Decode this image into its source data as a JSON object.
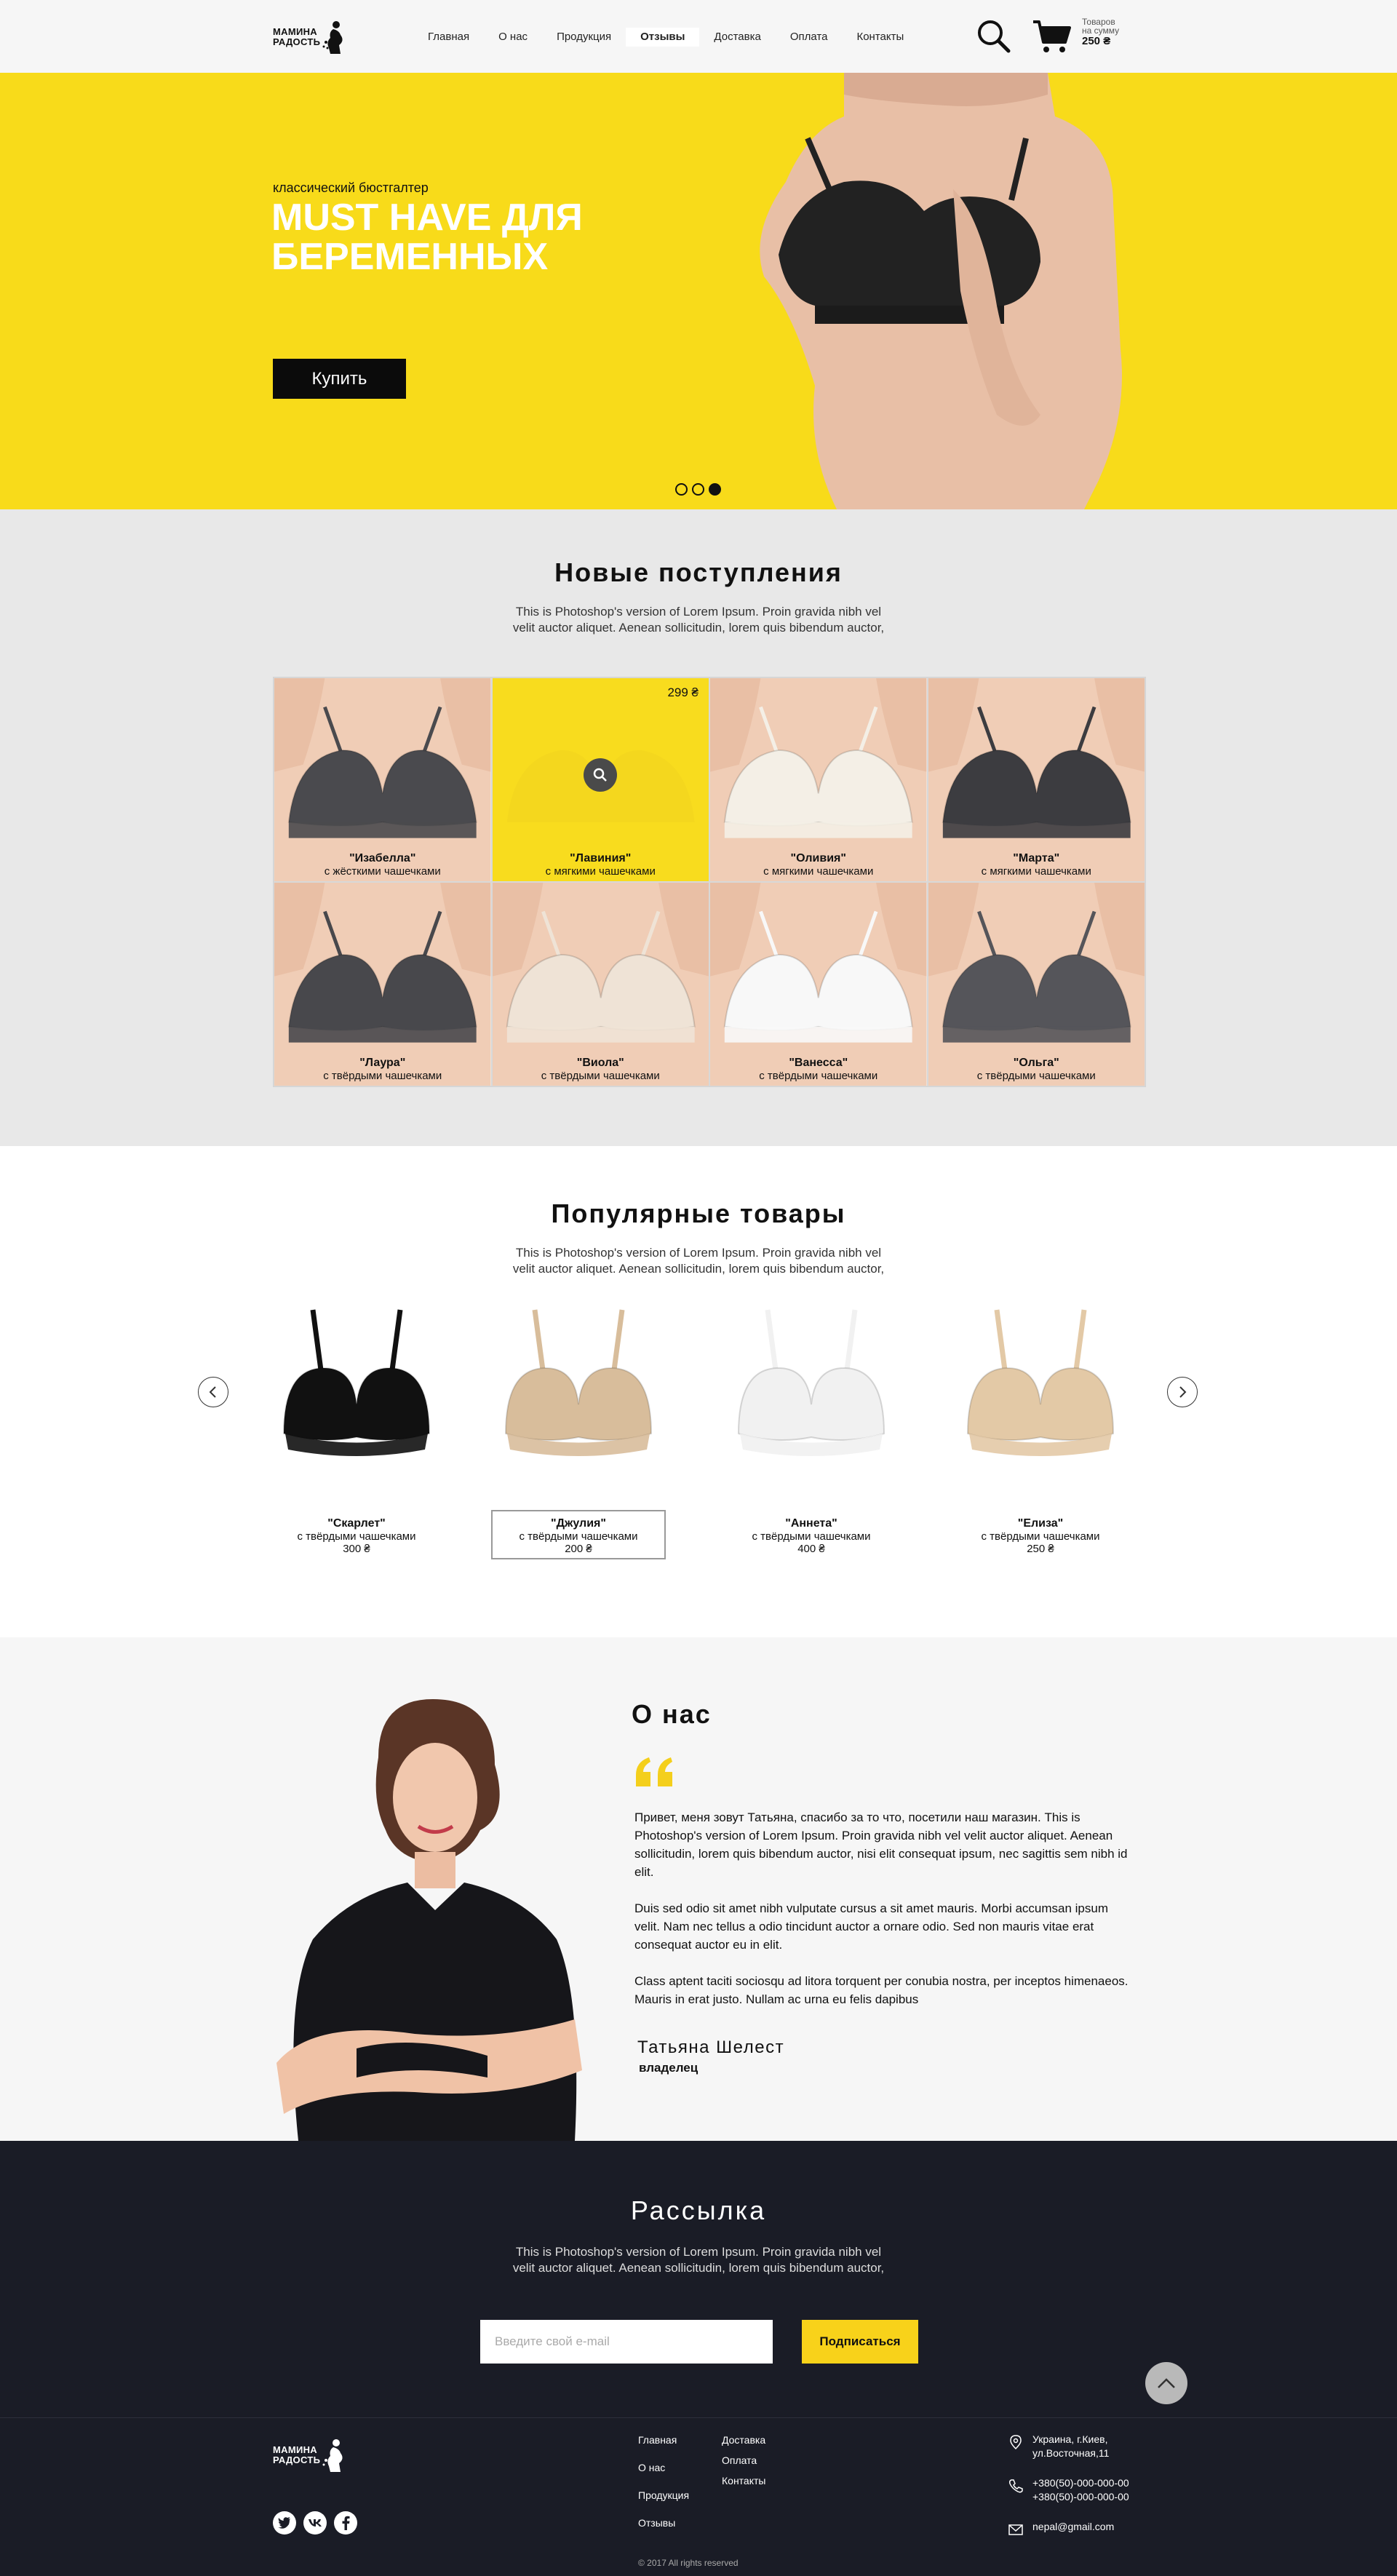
{
  "header": {
    "logo_line1": "МАМИНА",
    "logo_line2": "РАДОСТЬ",
    "nav": [
      "Главная",
      "О нас",
      "Продукция",
      "Отзывы",
      "Доставка",
      "Оплата",
      "Контакты"
    ],
    "active_nav": "Отзывы",
    "cart_label1": "Товаров",
    "cart_label2": "на сумму",
    "cart_sum": "250 ₴"
  },
  "hero": {
    "subtitle": "классический бюстгалтер",
    "title_line1": "MUST HAVE ДЛЯ",
    "title_line2": "БЕРЕМЕННЫХ",
    "button": "Купить",
    "slides": 3,
    "active_slide": 3
  },
  "new_arrivals": {
    "title": "Новые поступления",
    "desc_line1": "This is Photoshop's version  of Lorem Ipsum. Proin gravida nibh vel",
    "desc_line2": "velit auctor aliquet. Aenean sollicitudin, lorem quis bibendum auctor,",
    "items": [
      {
        "name": "\"Изабелла\"",
        "desc": "с жёсткими чашечками",
        "color": "#4a4a4e"
      },
      {
        "name": "\"Лавиния\"",
        "desc": "с мягкими чашечками",
        "color": "#f8dc1e",
        "price": "299 ₴",
        "highlighted": true
      },
      {
        "name": "\"Оливия\"",
        "desc": "с мягкими чашечками",
        "color": "#f4efe6"
      },
      {
        "name": "\"Марта\"",
        "desc": "с мягкими чашечками",
        "color": "#3c3c40"
      },
      {
        "name": "\"Лаура\"",
        "desc": "с твёрдыми чашечками",
        "color": "#48484c"
      },
      {
        "name": "\"Виола\"",
        "desc": "с твёрдыми чашечками",
        "color": "#efe3d6"
      },
      {
        "name": "\"Ванесса\"",
        "desc": "с твёрдыми чашечками",
        "color": "#f8f8f8"
      },
      {
        "name": "\"Ольга\"",
        "desc": "с твёрдыми чашечками",
        "color": "#55555a"
      }
    ]
  },
  "popular": {
    "title": "Популярные товары",
    "desc_line1": "This is Photoshop's version  of Lorem Ipsum. Proin gravida nibh vel",
    "desc_line2": "velit auctor aliquet. Aenean sollicitudin, lorem quis bibendum auctor,",
    "items": [
      {
        "name": "\"Скарлет\"",
        "desc": "с твёрдыми чашечками",
        "price": "300 ₴",
        "color": "#111111"
      },
      {
        "name": "\"Джулия\"",
        "desc": "с твёрдыми чашечками",
        "price": "200 ₴",
        "color": "#d8bd9b",
        "selected": true
      },
      {
        "name": "\"Аннета\"",
        "desc": "с твёрдыми чашечками",
        "price": "400 ₴",
        "color": "#f1f1f1"
      },
      {
        "name": "\"Елиза\"",
        "desc": "с твёрдыми чашечками",
        "price": "250 ₴",
        "color": "#e3c9a6"
      }
    ]
  },
  "about": {
    "title": "О нас",
    "p1": "Привет, меня зовут Татьяна, спасибо за то что, посетили наш магазин. This is Photoshop's version  of Lorem Ipsum. Proin gravida nibh vel velit auctor aliquet. Aenean sollicitudin, lorem quis bibendum auctor, nisi elit consequat ipsum, nec sagittis sem nibh id elit.",
    "p2": "Duis sed odio sit amet nibh vulputate cursus a sit amet mauris. Morbi accumsan ipsum velit. Nam nec tellus a odio tincidunt auctor a ornare odio. Sed non  mauris vitae erat consequat auctor eu in elit.",
    "p3": "Class aptent taciti sociosqu ad litora torquent per conubia nostra, per inceptos himenaeos. Mauris in erat justo. Nullam ac urna eu felis dapibus",
    "name": "Татьяна Шелест",
    "role": "владелец"
  },
  "newsletter": {
    "title": "Рассылка",
    "desc_line1": "This is Photoshop's version  of Lorem Ipsum. Proin gravida nibh vel",
    "desc_line2": "velit auctor aliquet. Aenean sollicitudin, lorem quis bibendum auctor,",
    "placeholder": "Введите свой e-mail",
    "button": "Подписаться"
  },
  "footer": {
    "nav_col1": [
      "Главная",
      "О нас",
      "Продукция",
      "Отзывы"
    ],
    "nav_col2": [
      "Доставка",
      "Оплата",
      "Контакты"
    ],
    "address_line1": "Украина, г.Киев,",
    "address_line2": "ул.Восточная,11",
    "phone1": "+380(50)-000-000-00",
    "phone2": "+380(50)-000-000-00",
    "email": "nepal@gmail.com",
    "copyright": "© 2017 All rights reserved"
  },
  "colors": {
    "accent": "#f8db1a",
    "dark": "#1a1c26",
    "light_bg": "#e8e8e8"
  }
}
